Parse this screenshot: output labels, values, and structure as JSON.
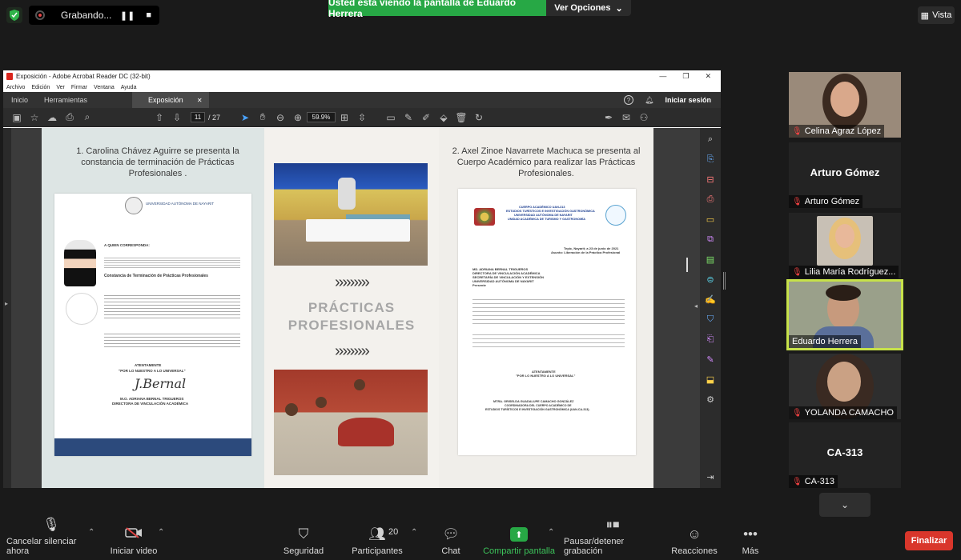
{
  "top": {
    "recording_label": "Grabando...",
    "share_banner": "Usted está viendo la pantalla de Eduardo Herrera",
    "view_options": "Ver Opciones",
    "view_label": "Vista"
  },
  "acrobat": {
    "title": "Exposición - Adobe Acrobat Reader DC (32-bit)",
    "menu": [
      "Archivo",
      "Edición",
      "Ver",
      "Firmar",
      "Ventana",
      "Ayuda"
    ],
    "tabs": {
      "home": "Inicio",
      "tools": "Herramientas",
      "document": "Exposición"
    },
    "login": "Iniciar sesión",
    "page_current": "11",
    "page_total": "/ 27",
    "zoom": "59.9%"
  },
  "pdf": {
    "left_heading": "1.    Carolina Chávez Aguirre se presenta la constancia de terminación de Prácticas Profesionales .",
    "right_heading": "2. Axel Zinoe Navarrete Machuca se presenta al Cuerpo Académico para realizar las Prácticas Profesionales.",
    "chevrons": "›››››››››",
    "center_title": "PRÁCTICAS PROFESIONALES",
    "letter1": {
      "university": "UNIVERSIDAD AUTÓNOMA DE NAYARIT",
      "salutation": "A QUIEN CORRESPONDA:",
      "subject": "Constancia de Terminación de Prácticas Profesionales",
      "closing": "ATENTAMENTE",
      "motto": "\"POR LO NUESTRO A LO UNIVERSAL\"",
      "signer": "M.O. ADRIANA BERNAL TRIGUEROS",
      "signer_title": "DIRECTORA DE VINCULACIÓN ACADÉMICA"
    },
    "letter2": {
      "header_line1": "CUERPO ACADÉMICO UAN-313",
      "header_line2": "ESTUDIOS TURÍSTICOS E INVESTIGACIÓN GASTRONÓMICA",
      "header_line3": "UNIVERSIDAD AUTÓNOMA DE NAYARIT",
      "header_line4": "UNIDAD ACADÉMICA DE TURISMO Y GASTRONOMÍA",
      "date": "Tepic, Nayarit; a 23 de junio de 2021",
      "subject": "Asunto: Liberación de la Práctica Profesional",
      "recipient1": "MD. ADRIANA BERNAL TRIGUEROS",
      "recipient2": "DIRECTORA DE VINCULACIÓN ACADÉMICA",
      "recipient3": "SECRETARÍA DE VINCULACIÓN Y EXTENSIÓN",
      "recipient4": "UNIVERSIDAD AUTÓNOMA DE NAYARIT",
      "recipient5": "Presente",
      "closing": "ATENTAMENTE",
      "motto": "\"POR LO NUESTRO A LO UNIVERSAL\"",
      "signer": "MTRA. GRISELDA GUADALUPE CAMACHO GONZÁLEZ",
      "signer_title1": "COORDINADORA DEL CUERPO ACADÉMICO DE",
      "signer_title2": "ESTUDIOS TURÍSTICOS E INVESTIGACIÓN GASTRONÓMICA (UAN-CA-313)."
    }
  },
  "participants": [
    {
      "name": "Celina Agraz López",
      "center": ""
    },
    {
      "name": "Arturo Gómez",
      "center": "Arturo Gómez"
    },
    {
      "name": "Lilia María Rodríguez...",
      "center": ""
    },
    {
      "name": "Eduardo Herrera",
      "center": ""
    },
    {
      "name": "YOLANDA CAMACHO",
      "center": ""
    },
    {
      "name": "CA-313",
      "center": "CA-313"
    }
  ],
  "bottom": {
    "mute": "Cancelar silenciar ahora",
    "video": "Iniciar video",
    "security": "Seguridad",
    "participants": "Participantes",
    "participants_count": "20",
    "chat": "Chat",
    "share": "Compartir pantalla",
    "record": "Pausar/detener grabación",
    "reactions": "Reacciones",
    "more": "Más",
    "end": "Finalizar"
  }
}
